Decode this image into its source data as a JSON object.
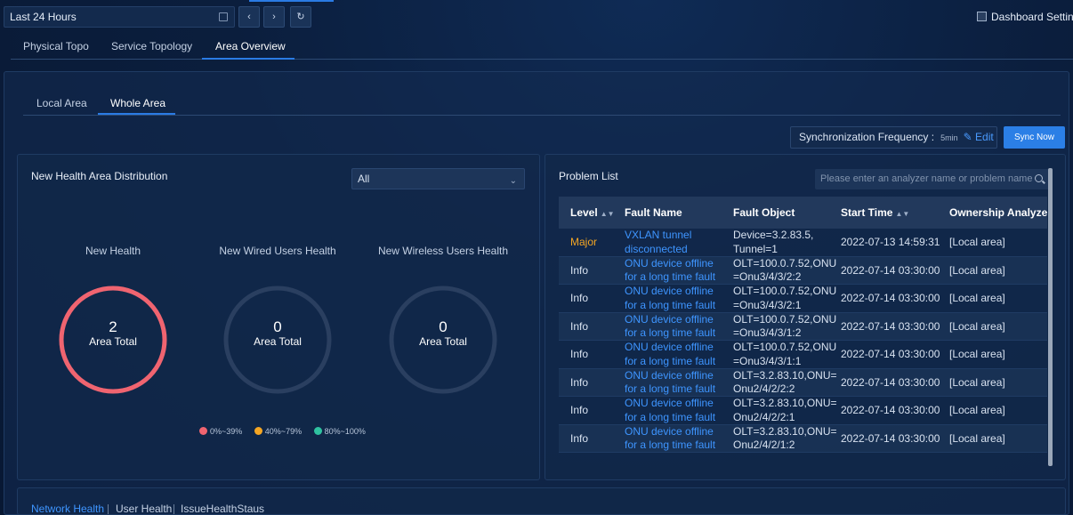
{
  "toolbar": {
    "time_range": "Last 24 Hours",
    "prev_icon": "chevron-left-icon",
    "next_icon": "chevron-right-icon",
    "refresh_icon": "refresh-icon",
    "dashboard_settings": "Dashboard Setting"
  },
  "main_tabs": [
    {
      "label": "Physical Topo",
      "active": false
    },
    {
      "label": "Service Topology",
      "active": false
    },
    {
      "label": "Area Overview",
      "active": true
    }
  ],
  "sub_tabs": [
    {
      "label": "Local Area",
      "active": false
    },
    {
      "label": "Whole Area",
      "active": true
    }
  ],
  "sync": {
    "label": "Synchronization Frequency :",
    "frequency": "5min",
    "edit_label": "Edit",
    "sync_now_label": "Sync Now"
  },
  "health_card": {
    "title": "New Health Area Distribution",
    "filter_value": "All",
    "gauges": [
      {
        "title": "New Health",
        "value": "2",
        "label": "Area Total",
        "fill_fraction": 1.0,
        "color": "#f06470"
      },
      {
        "title": "New Wired Users Health",
        "value": "0",
        "label": "Area Total",
        "fill_fraction": 0,
        "color": "#2a3f60"
      },
      {
        "title": "New Wireless Users Health",
        "value": "0",
        "label": "Area Total",
        "fill_fraction": 0,
        "color": "#2a3f60"
      }
    ],
    "legend": [
      {
        "label": "0%~39%",
        "color": "#f06470"
      },
      {
        "label": "40%~79%",
        "color": "#f5a623"
      },
      {
        "label": "80%~100%",
        "color": "#2fc2a0"
      }
    ]
  },
  "problem_list": {
    "title": "Problem List",
    "search_placeholder": "Please enter an analyzer name or problem name",
    "columns": [
      "Level",
      "Fault Name",
      "Fault Object",
      "Start Time",
      "Ownership Analyzer"
    ],
    "rows": [
      {
        "level": "Major",
        "fault_name_1": "VXLAN tunnel",
        "fault_name_2": "disconnected",
        "object_1": "Device=3.2.83.5,",
        "object_2": "Tunnel=1",
        "start_time": "2022-07-13 14:59:31",
        "analyzer": "[Local area]"
      },
      {
        "level": "Info",
        "fault_name_1": "ONU device offline",
        "fault_name_2": "for a long time fault",
        "object_1": "OLT=100.0.7.52,ONU",
        "object_2": "=Onu3/4/3/2:2",
        "start_time": "2022-07-14 03:30:00",
        "analyzer": "[Local area]"
      },
      {
        "level": "Info",
        "fault_name_1": "ONU device offline",
        "fault_name_2": "for a long time fault",
        "object_1": "OLT=100.0.7.52,ONU",
        "object_2": "=Onu3/4/3/2:1",
        "start_time": "2022-07-14 03:30:00",
        "analyzer": "[Local area]"
      },
      {
        "level": "Info",
        "fault_name_1": "ONU device offline",
        "fault_name_2": "for a long time fault",
        "object_1": "OLT=100.0.7.52,ONU",
        "object_2": "=Onu3/4/3/1:2",
        "start_time": "2022-07-14 03:30:00",
        "analyzer": "[Local area]"
      },
      {
        "level": "Info",
        "fault_name_1": "ONU device offline",
        "fault_name_2": "for a long time fault",
        "object_1": "OLT=100.0.7.52,ONU",
        "object_2": "=Onu3/4/3/1:1",
        "start_time": "2022-07-14 03:30:00",
        "analyzer": "[Local area]"
      },
      {
        "level": "Info",
        "fault_name_1": "ONU device offline",
        "fault_name_2": "for a long time fault",
        "object_1": "OLT=3.2.83.10,ONU=",
        "object_2": "Onu2/4/2/2:2",
        "start_time": "2022-07-14 03:30:00",
        "analyzer": "[Local area]"
      },
      {
        "level": "Info",
        "fault_name_1": "ONU device offline",
        "fault_name_2": "for a long time fault",
        "object_1": "OLT=3.2.83.10,ONU=",
        "object_2": "Onu2/4/2/2:1",
        "start_time": "2022-07-14 03:30:00",
        "analyzer": "[Local area]"
      },
      {
        "level": "Info",
        "fault_name_1": "ONU device offline",
        "fault_name_2": "for a long time fault",
        "object_1": "OLT=3.2.83.10,ONU=",
        "object_2": "Onu2/4/2/1:2",
        "start_time": "2022-07-14 03:30:00",
        "analyzer": "[Local area]"
      }
    ]
  },
  "bottom_tabs": [
    {
      "label": "Network Health",
      "active": true
    },
    {
      "label": "User Health",
      "active": false
    },
    {
      "label": "IssueHealthStaus",
      "active": false
    }
  ]
}
